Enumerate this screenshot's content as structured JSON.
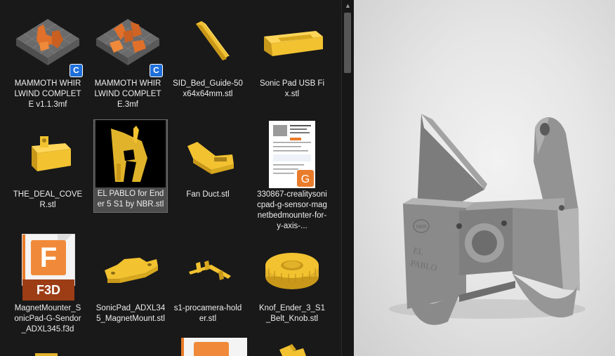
{
  "files": [
    {
      "name": "MAMMOTH WHIRLWIND COMPLETE v1.1.3mf",
      "icon": "3mf-model-thumbnail",
      "badge": "C"
    },
    {
      "name": "MAMMOTH WHIRLWIND COMPLETE.3mf",
      "icon": "3mf-model-thumbnail",
      "badge": "C"
    },
    {
      "name": "SID_Bed_Guide-50x64x64mm.stl",
      "icon": "stl-model-thumbnail"
    },
    {
      "name": "Sonic Pad USB Fix.stl",
      "icon": "stl-model-thumbnail"
    },
    {
      "name": "THE_DEAL_COVER.stl",
      "icon": "stl-model-thumbnail"
    },
    {
      "name": "EL PABLO for Ender 5 S1 by NBR.stl",
      "icon": "image-thumbnail",
      "selected": true
    },
    {
      "name": "Fan Duct.stl",
      "icon": "stl-model-thumbnail"
    },
    {
      "name": "330867-crealitysonicpad-g-sensor-magnetbedmounter-for-y-axis-...",
      "icon": "pdf-document-thumbnail"
    },
    {
      "name": "MagnetMounter_SonicPad-G-Sendor_ADXL345.f3d",
      "icon": "fusion-360-icon",
      "icon_label": "F3D",
      "icon_letter": "F"
    },
    {
      "name": "SonicPad_ADXL345_MagnetMount.stl",
      "icon": "stl-model-thumbnail"
    },
    {
      "name": "s1-procamera-holder.stl",
      "icon": "stl-model-thumbnail"
    },
    {
      "name": "Knof_Ender_3_S1_Belt_Knob.stl",
      "icon": "stl-model-thumbnail"
    }
  ],
  "preview": {
    "model_text_1": "EL",
    "model_text_2": "PABLO",
    "logo_text": "NBR"
  },
  "colors": {
    "background": "#191919",
    "text": "#ededed",
    "selection": "#4d4d4d",
    "model_yellow": "#f2c230",
    "model_orange": "#e0702a",
    "preview_gray": "#8f8f8f",
    "badge_blue": "#1e6fd9"
  }
}
